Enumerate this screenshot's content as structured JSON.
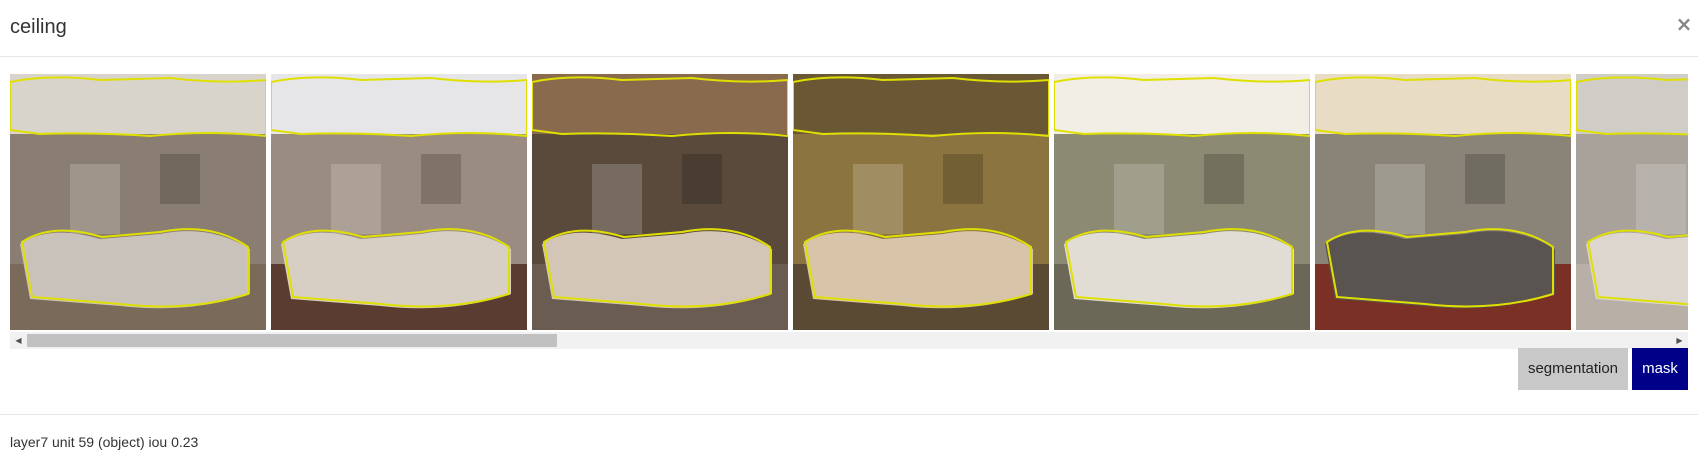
{
  "dialog": {
    "title": "ceiling",
    "close_glyph": "×",
    "close_icon": "close-icon"
  },
  "gallery": {
    "images": [
      {
        "index": 1,
        "scene": "living room with sofa, ceiling highlighted"
      },
      {
        "index": 2,
        "scene": "living room with fireplace, ceiling highlighted"
      },
      {
        "index": 3,
        "scene": "room with sofa and mirror, ceiling highlighted"
      },
      {
        "index": 4,
        "scene": "wall with framed pictures above sofa"
      },
      {
        "index": 5,
        "scene": "bright room with sofa, ceiling highlighted"
      },
      {
        "index": 6,
        "scene": "room with window curtains and sofa"
      },
      {
        "index": 7,
        "scene": "bedroom partially visible"
      }
    ],
    "scroll_left_glyph": "◀",
    "scroll_right_glyph": "▶",
    "scroll_position_fraction": 0.0
  },
  "view_toggle": {
    "segmentation_label": "segmentation",
    "mask_label": "mask",
    "selected": "mask"
  },
  "footer": {
    "info": "layer7 unit 59 (object) iou 0.23"
  },
  "colors": {
    "mask_active": "#000088",
    "segmentation_bg": "#c8c8c8",
    "outline": "#e0e000"
  }
}
